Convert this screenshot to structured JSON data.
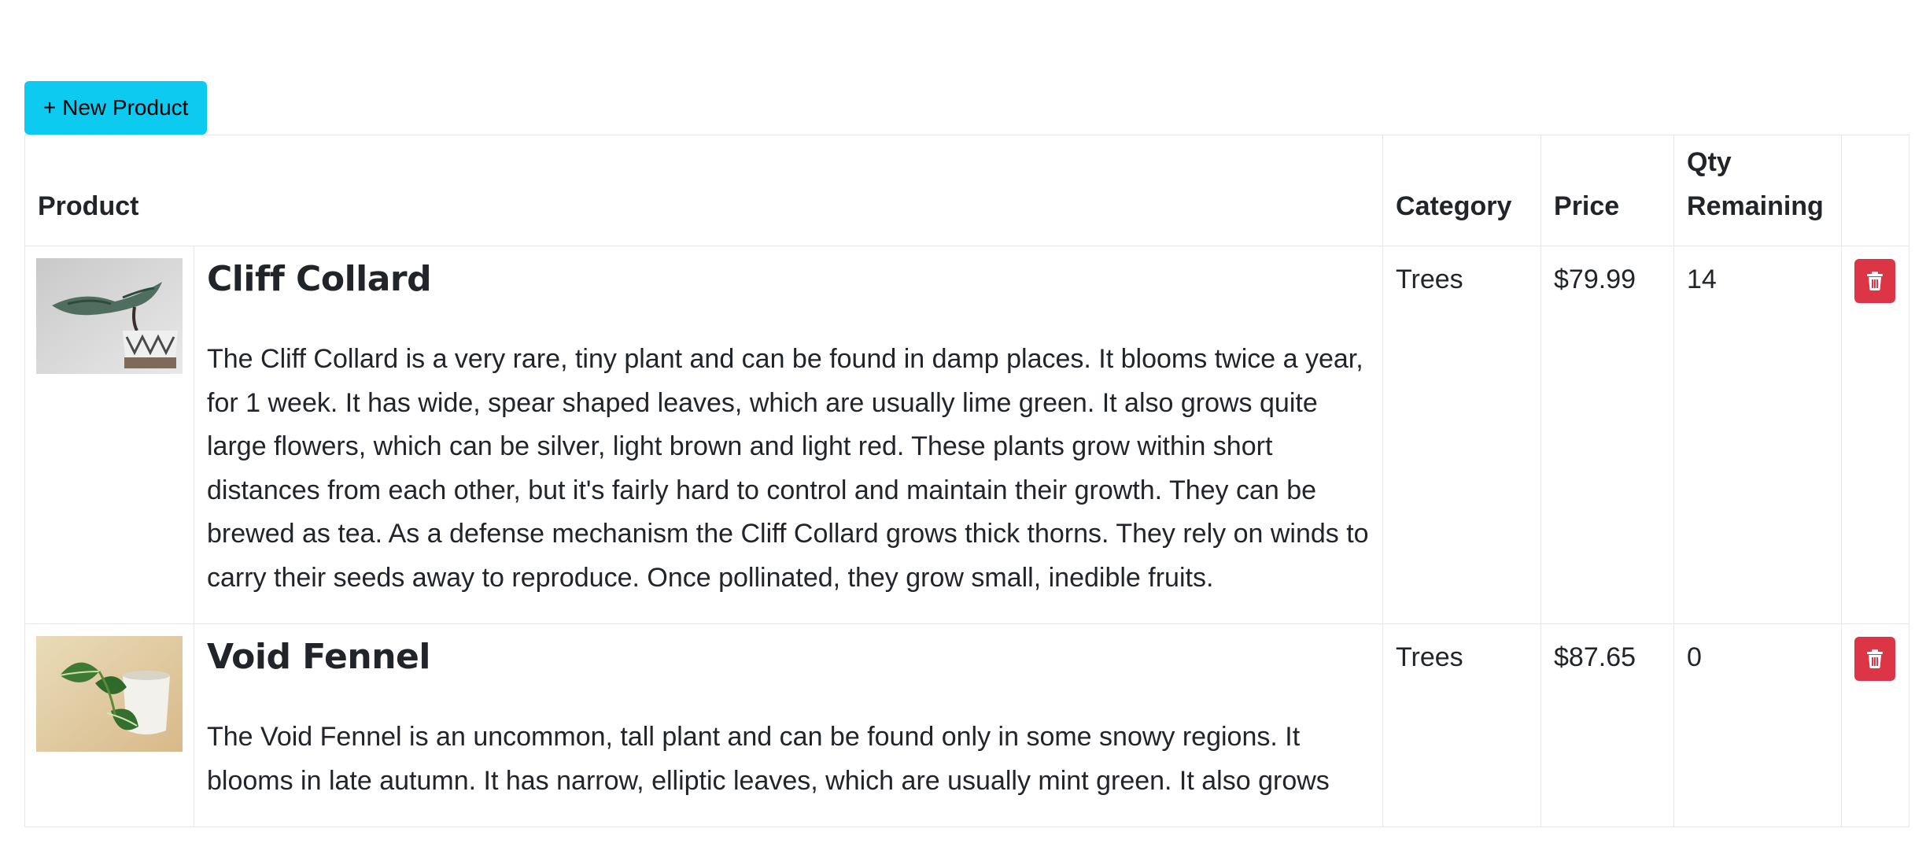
{
  "toolbar": {
    "new_product_label": "+ New Product"
  },
  "table": {
    "headers": {
      "product": "Product",
      "category": "Category",
      "price": "Price",
      "qty": "Qty Remaining"
    },
    "rows": [
      {
        "name": "Cliff Collard",
        "description": "The Cliff Collard is a very rare, tiny plant and can be found in damp places. It blooms twice a year, for 1 week. It has wide, spear shaped leaves, which are usually lime green. It also grows quite large flowers, which can be silver, light brown and light red. These plants grow within short distances from each other, but it's fairly hard to control and maintain their growth. They can be brewed as tea. As a defense mechanism the Cliff Collard grows thick thorns. They rely on winds to carry their seeds away to reproduce. Once pollinated, they grow small, inedible fruits.",
        "category": "Trees",
        "price": "$79.99",
        "qty": "14"
      },
      {
        "name": "Void Fennel",
        "description": "The Void Fennel is an uncommon, tall plant and can be found only in some snowy regions. It blooms in late autumn. It has narrow, elliptic leaves, which are usually mint green. It also grows",
        "category": "Trees",
        "price": "$87.65",
        "qty": "0"
      }
    ]
  },
  "icons": {
    "delete": "trash-icon"
  },
  "colors": {
    "primary_button": "#0dcaf0",
    "danger_button": "#dc3545",
    "border": "#e5e7ea",
    "text": "#212529"
  }
}
